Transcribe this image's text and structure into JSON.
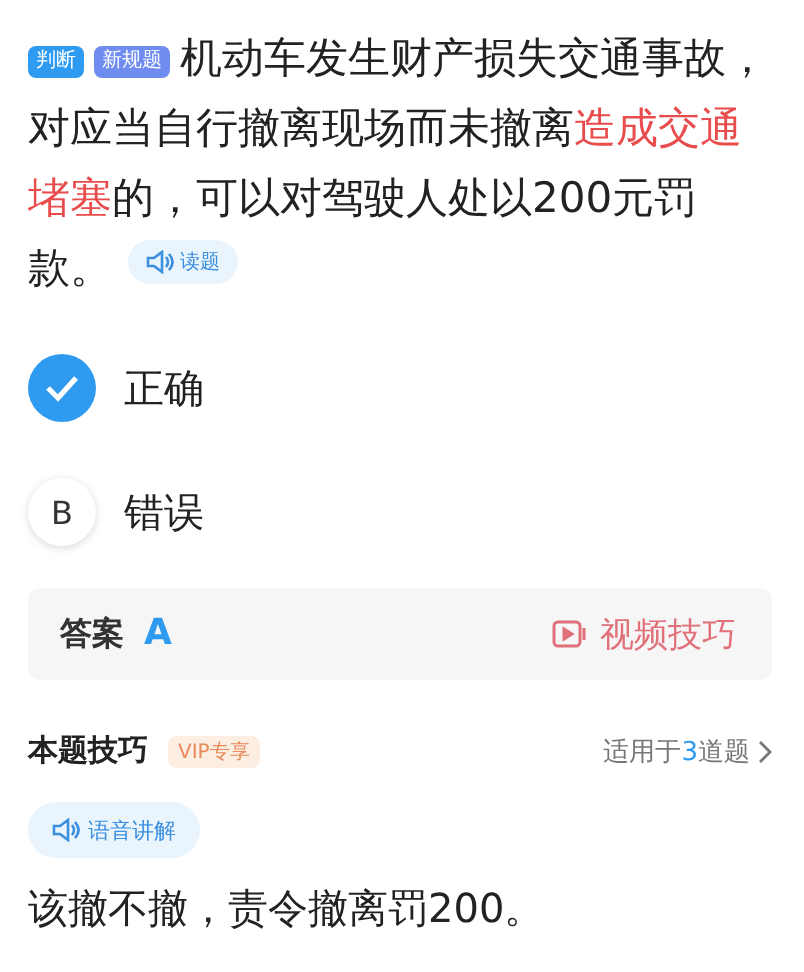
{
  "question": {
    "tags": [
      {
        "text": "判断",
        "color": "#2f9bf0"
      },
      {
        "text": "新规题",
        "color": "#6f8cf0"
      }
    ],
    "parts": [
      {
        "text": "机动车发生财产损失交通事故，对应当自行撤离现场而未撤离",
        "highlight": false
      },
      {
        "text": "造成交通堵塞",
        "highlight": true
      },
      {
        "text": "的，可以对驾驶人处以200元罚款。",
        "highlight": false
      }
    ],
    "read_button": "读题"
  },
  "options": [
    {
      "text": "正确",
      "selected": true
    },
    {
      "letter": "B",
      "text": "错误",
      "selected": false
    }
  ],
  "answer": {
    "label": "答案",
    "value": "A",
    "video_link": "视频技巧"
  },
  "tips": {
    "title": "本题技巧",
    "badge": "VIP专享",
    "applies_prefix": "适用于",
    "applies_count": "3",
    "applies_suffix": "道题",
    "voice_button": "语音讲解",
    "text": "该撤不撤，责令撤离罚200。"
  }
}
